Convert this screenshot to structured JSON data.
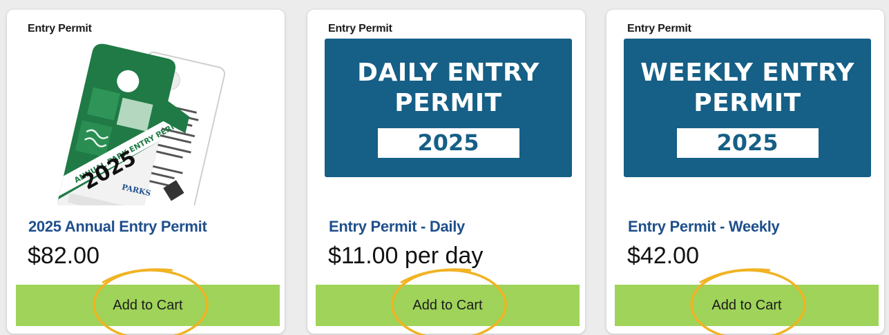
{
  "products": [
    {
      "category": "Entry Permit",
      "image_name": "annual-hang-tag-image",
      "image_text": {
        "top_label": "ANNUAL PARK ENTRY PERMIT",
        "year": "2025"
      },
      "title": "2025 Annual Entry Permit",
      "price": "$82.00",
      "button_label": "Add to Cart"
    },
    {
      "category": "Entry Permit",
      "banner": {
        "line1": "DAILY ENTRY",
        "line2": "PERMIT",
        "year": "2025"
      },
      "title": "Entry Permit - Daily",
      "price": "$11.00 per day",
      "button_label": "Add to Cart"
    },
    {
      "category": "Entry Permit",
      "banner": {
        "line1": "WEEKLY ENTRY",
        "line2": "PERMIT",
        "year": "2025"
      },
      "title": "Entry Permit - Weekly",
      "price": "$42.00",
      "button_label": "Add to Cart"
    }
  ],
  "colors": {
    "banner_blue": "#165f86",
    "title_blue": "#1f4f8c",
    "button_green": "#9fd35a",
    "highlight_circle": "#f0b323",
    "tag_green": "#1f7a45"
  }
}
